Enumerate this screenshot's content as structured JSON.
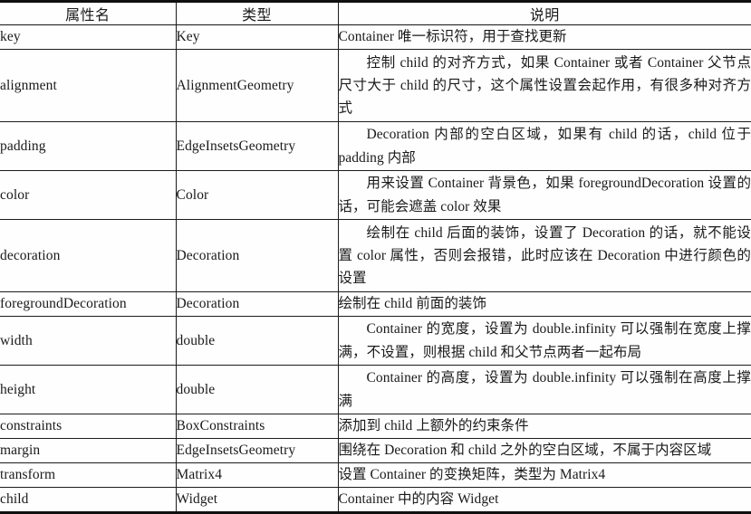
{
  "table": {
    "headers": [
      "属性名",
      "类型",
      "说明"
    ],
    "rows": [
      {
        "name": "key",
        "type": "Key",
        "desc": "Container 唯一标识符，用于查找更新",
        "lines": 1,
        "indent": false
      },
      {
        "name": "alignment",
        "type": "AlignmentGeometry",
        "desc": "控制 child 的对齐方式，如果 Container 或者 Container 父节点尺寸大于 child 的尺寸，这个属性设置会起作用，有很多种对齐方式",
        "lines": 3,
        "indent": true
      },
      {
        "name": "padding",
        "type": "EdgeInsetsGeometry",
        "desc": "Decoration 内部的空白区域，如果有 child 的话，child 位于 padding 内部",
        "lines": 2,
        "indent": true
      },
      {
        "name": "color",
        "type": "Color",
        "desc": "用来设置 Container 背景色，如果 foregroundDecoration 设置的话，可能会遮盖 color 效果",
        "lines": 2,
        "indent": true
      },
      {
        "name": "decoration",
        "type": "Decoration",
        "desc": "绘制在 child 后面的装饰，设置了 Decoration 的话，就不能设置 color 属性，否则会报错，此时应该在 Decoration 中进行颜色的设置",
        "lines": 3,
        "indent": true
      },
      {
        "name": "foregroundDecoration",
        "type": "Decoration",
        "desc": "绘制在 child 前面的装饰",
        "lines": 1,
        "indent": false
      },
      {
        "name": "width",
        "type": "double",
        "desc": "Container 的宽度，设置为 double.infinity 可以强制在宽度上撑满，不设置，则根据 child 和父节点两者一起布局",
        "lines": 2,
        "indent": true
      },
      {
        "name": "height",
        "type": "double",
        "desc": "Container 的高度，设置为 double.infinity 可以强制在高度上撑满",
        "lines": 2,
        "indent": true
      },
      {
        "name": "constraints",
        "type": "BoxConstraints",
        "desc": "添加到 child 上额外的约束条件",
        "lines": 1,
        "indent": false
      },
      {
        "name": "margin",
        "type": "EdgeInsetsGeometry",
        "desc": "围绕在 Decoration 和 child 之外的空白区域，不属于内容区域",
        "lines": 1,
        "indent": false
      },
      {
        "name": "transform",
        "type": "Matrix4",
        "desc": "设置 Container 的变换矩阵，类型为 Matrix4",
        "lines": 1,
        "indent": false
      },
      {
        "name": "child",
        "type": "Widget",
        "desc": "Container 中的内容 Widget",
        "lines": 1,
        "indent": false
      }
    ]
  },
  "style": {
    "rule_color": "#1c1c1c",
    "text_color": "#1a1a1a",
    "page_background": "#fefefe"
  }
}
